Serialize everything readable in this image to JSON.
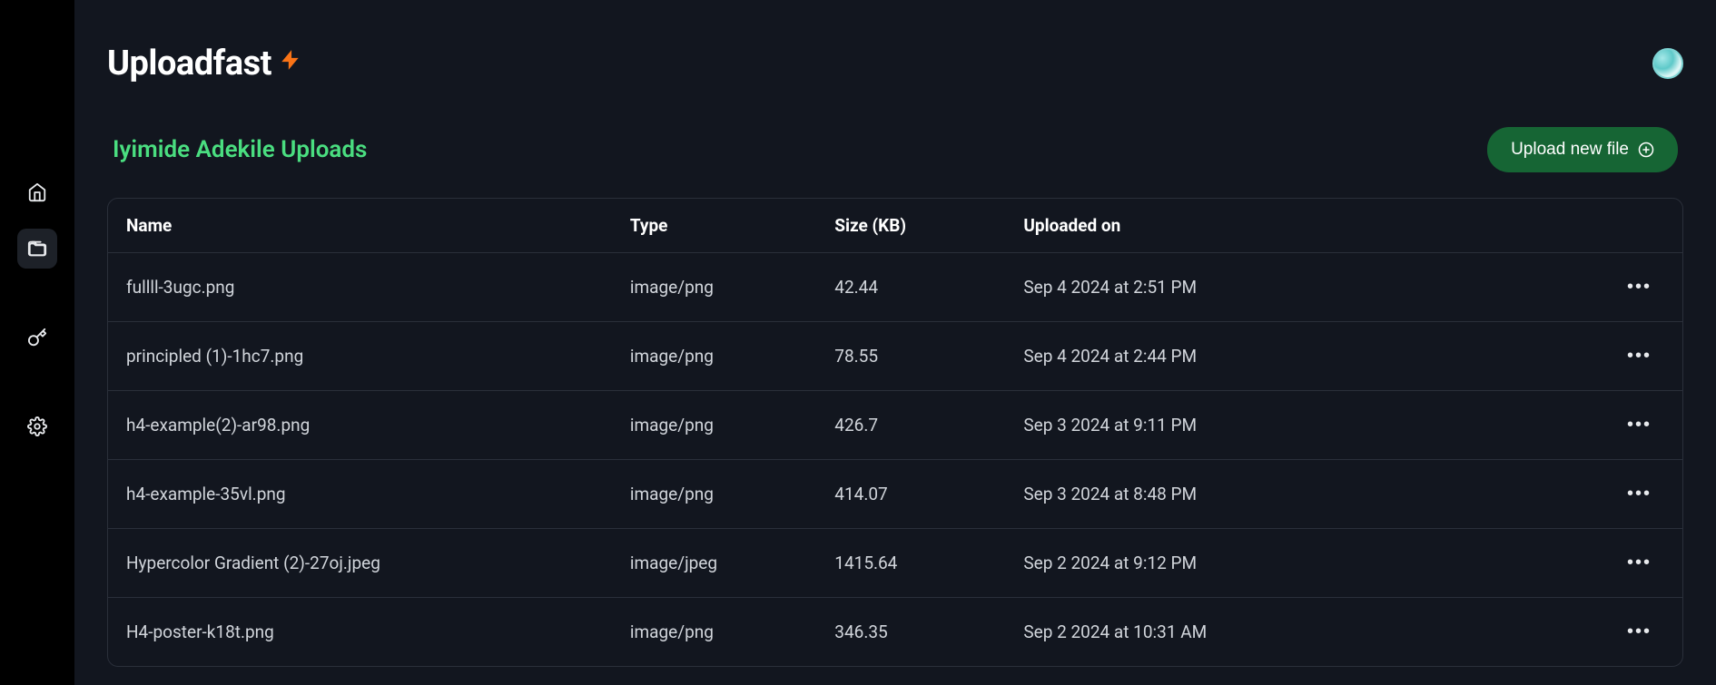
{
  "app": {
    "title": "Uploadfast"
  },
  "page": {
    "title": "Iyimide Adekile Uploads",
    "uploadButtonLabel": "Upload new file"
  },
  "table": {
    "headers": {
      "name": "Name",
      "type": "Type",
      "size": "Size (KB)",
      "uploaded": "Uploaded on"
    },
    "rows": [
      {
        "name": "fullll-3ugc.png",
        "type": "image/png",
        "size": "42.44",
        "uploaded": "Sep 4 2024 at 2:51 PM"
      },
      {
        "name": "principled (1)-1hc7.png",
        "type": "image/png",
        "size": "78.55",
        "uploaded": "Sep 4 2024 at 2:44 PM"
      },
      {
        "name": "h4-example(2)-ar98.png",
        "type": "image/png",
        "size": "426.7",
        "uploaded": "Sep 3 2024 at 9:11 PM"
      },
      {
        "name": "h4-example-35vl.png",
        "type": "image/png",
        "size": "414.07",
        "uploaded": "Sep 3 2024 at 8:48 PM"
      },
      {
        "name": "Hypercolor Gradient (2)-27oj.jpeg",
        "type": "image/jpeg",
        "size": "1415.64",
        "uploaded": "Sep 2 2024 at 9:12 PM"
      },
      {
        "name": "H4-poster-k18t.png",
        "type": "image/png",
        "size": "346.35",
        "uploaded": "Sep 2 2024 at 10:31 AM"
      }
    ]
  }
}
